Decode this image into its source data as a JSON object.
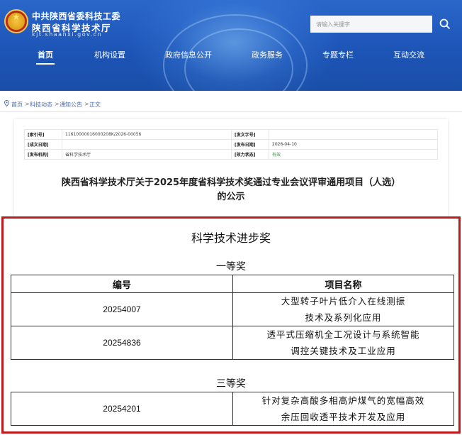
{
  "header": {
    "logo_line1": "中共陕西省委科技工委",
    "logo_line2": "陕西省科学技术厅",
    "logo_line3": "kjt.shaanxi.gov.cn",
    "search_placeholder": "请输入关键字",
    "nav": [
      {
        "label": "首页",
        "active": true
      },
      {
        "label": "机构设置"
      },
      {
        "label": "政府信息公开"
      },
      {
        "label": "政务服务"
      },
      {
        "label": "专题专栏"
      },
      {
        "label": "互动交流"
      }
    ]
  },
  "breadcrumb": [
    "首页",
    "科技动态",
    "通知公告",
    "正文"
  ],
  "meta": {
    "rows": [
      {
        "k1": "[索引号]",
        "v1": "11610000016000208K/2026-00056",
        "k2": "[发文字号]",
        "v2": ""
      },
      {
        "k1": "[成文日期]",
        "v1": "",
        "k2": "[发布日期]",
        "v2": "2026-04-10"
      },
      {
        "k1": "[发布机构]",
        "v1": "省科学技术厅",
        "k2": "[效力状态]",
        "v2": "有效"
      }
    ]
  },
  "article": {
    "title_line1": "陕西省科学技术厅关于2025年度省科学技术奖通过专业会议评审通用项目（人选）",
    "title_line2": "的公示"
  },
  "content": {
    "heading": "科学技术进步奖",
    "first_prize": "一等奖",
    "col_number": "编号",
    "col_name": "项目名称",
    "first_rows": [
      {
        "number": "20254007",
        "name_line1": "大型转子叶片低介入在线测振",
        "name_line2": "技术及系列化应用"
      },
      {
        "number": "20254836",
        "name_line1": "透平式压缩机全工况设计与系统智能",
        "name_line2": "调控关键技术及工业应用"
      }
    ],
    "third_prize": "三等奖",
    "third_rows": [
      {
        "number": "20254201",
        "name_line1": "针对复杂高酸多相高炉煤气的宽幅高效",
        "name_line2": "余压回收透平技术开发及应用"
      }
    ]
  },
  "colors": {
    "header_blue": "#1d55b7",
    "frame_red": "#c01919",
    "status_green": "#2b9a3a"
  }
}
